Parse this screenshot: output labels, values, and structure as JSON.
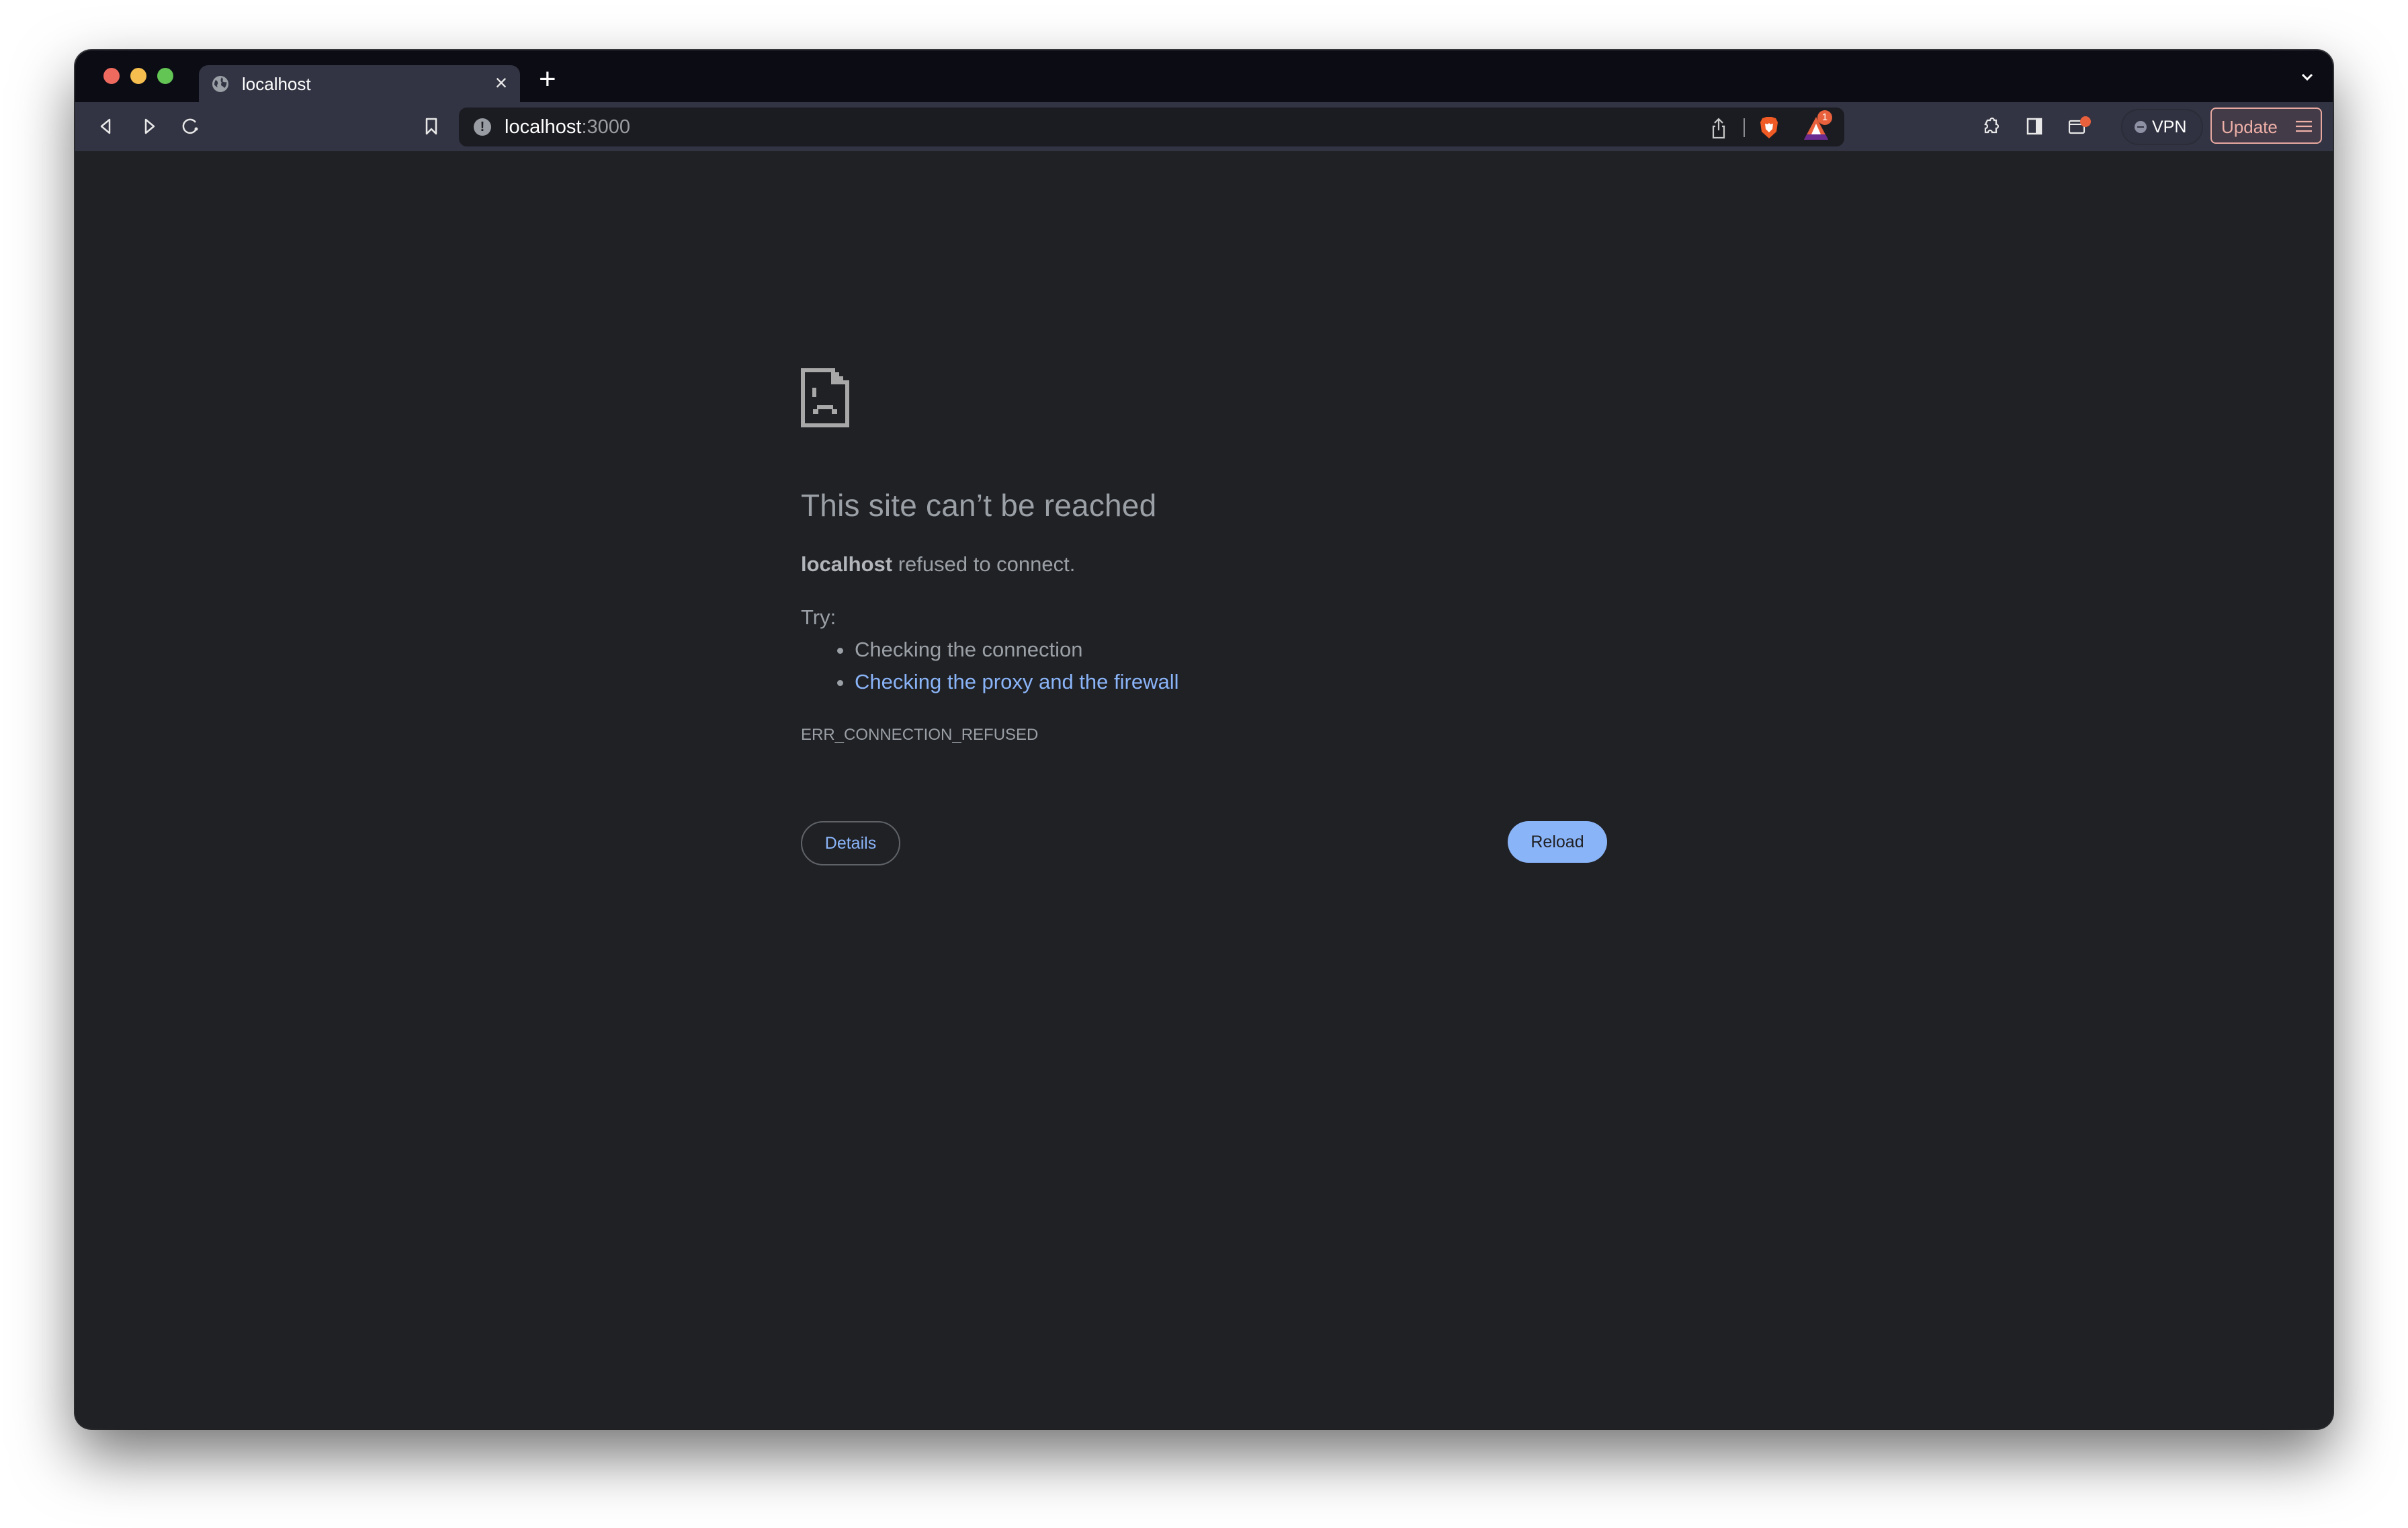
{
  "browser": {
    "tab": {
      "title": "localhost",
      "favicon": "globe-icon",
      "close_label": "×"
    },
    "new_tab_label": "+",
    "address_bar": {
      "host": "localhost",
      "port": ":3000",
      "security_icon": "info-icon"
    },
    "rewards_badge": "1",
    "vpn_label": "VPN",
    "update_label": "Update"
  },
  "page": {
    "heading": "This site can’t be reached",
    "message_host": "localhost",
    "message_rest": " refused to connect.",
    "try_label": "Try:",
    "suggestions": [
      {
        "text": "Checking the connection",
        "link": false
      },
      {
        "text": "Checking the proxy and the firewall",
        "link": true
      }
    ],
    "error_code": "ERR_CONNECTION_REFUSED",
    "details_button": "Details",
    "reload_button": "Reload"
  },
  "colors": {
    "link": "#8ab4f8",
    "primary_button": "#8ab4f8",
    "background": "#202125",
    "text": "#9aa0a6"
  }
}
